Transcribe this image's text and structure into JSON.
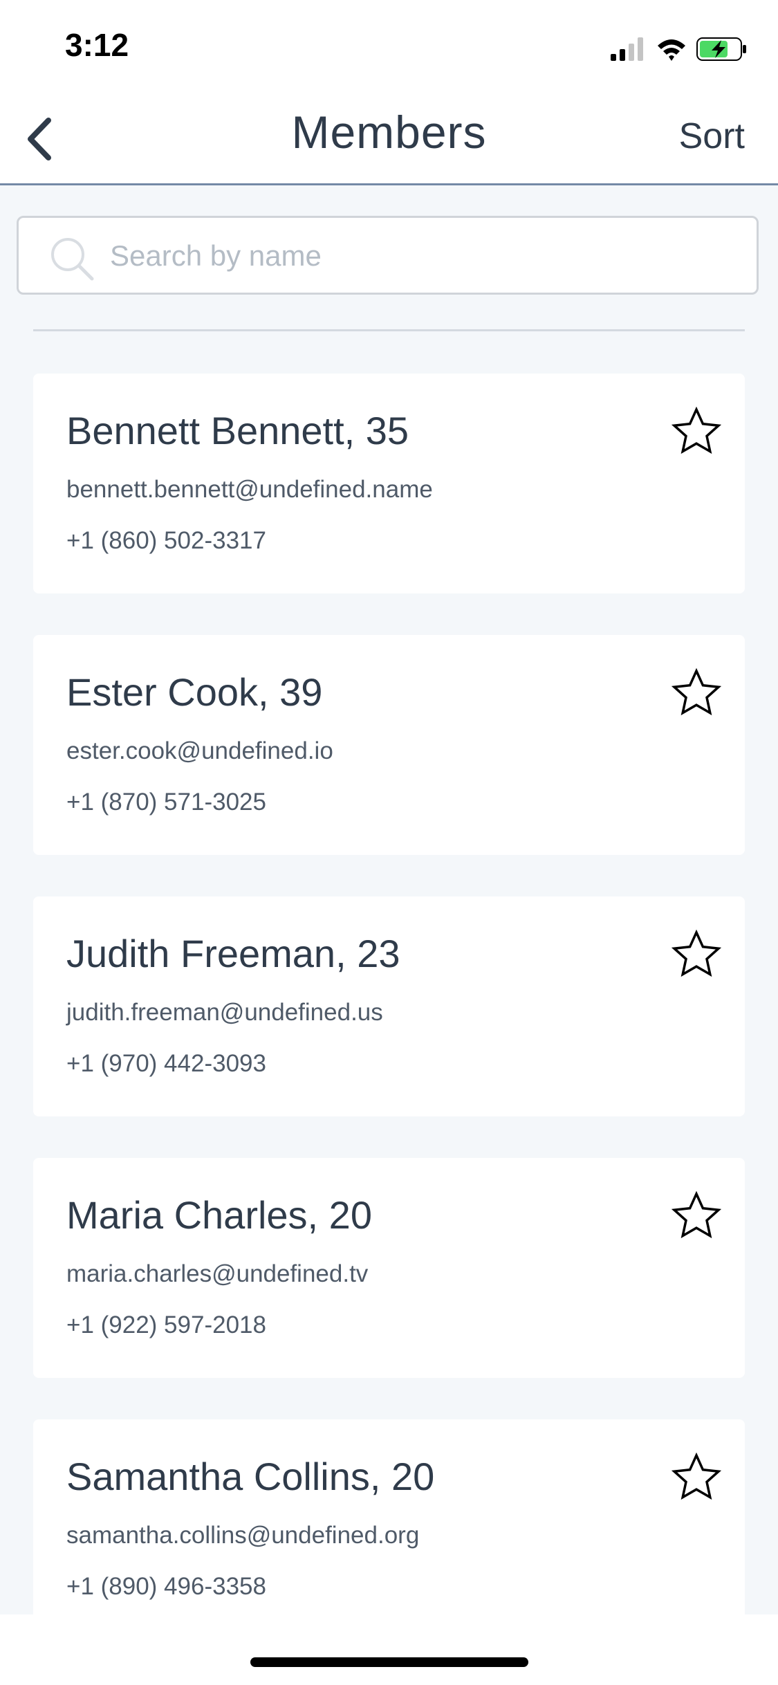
{
  "status_bar": {
    "time": "3:12",
    "signal_icon": "cellular-signal-icon",
    "wifi_icon": "wifi-icon",
    "battery_icon": "battery-charging-icon",
    "battery_color": "#4cd964"
  },
  "nav": {
    "back_icon": "chevron-left-icon",
    "title": "Members",
    "sort_label": "Sort"
  },
  "search": {
    "placeholder": "Search by name",
    "value": "",
    "icon": "search-icon"
  },
  "members": [
    {
      "name": "Bennett Bennett, 35",
      "email": "bennett.bennett@undefined.name",
      "phone": "+1 (860) 502-3317",
      "favorite": false
    },
    {
      "name": "Ester Cook, 39",
      "email": "ester.cook@undefined.io",
      "phone": "+1 (870) 571-3025",
      "favorite": false
    },
    {
      "name": "Judith Freeman, 23",
      "email": "judith.freeman@undefined.us",
      "phone": "+1 (970) 442-3093",
      "favorite": false
    },
    {
      "name": "Maria Charles, 20",
      "email": "maria.charles@undefined.tv",
      "phone": "+1 (922) 597-2018",
      "favorite": false
    },
    {
      "name": "Samantha Collins, 20",
      "email": "samantha.collins@undefined.org",
      "phone": "+1 (890) 496-3358",
      "favorite": false
    }
  ],
  "colors": {
    "background": "#f4f7fa",
    "text": "#2f3b4a",
    "nav_border": "#7489a6"
  }
}
